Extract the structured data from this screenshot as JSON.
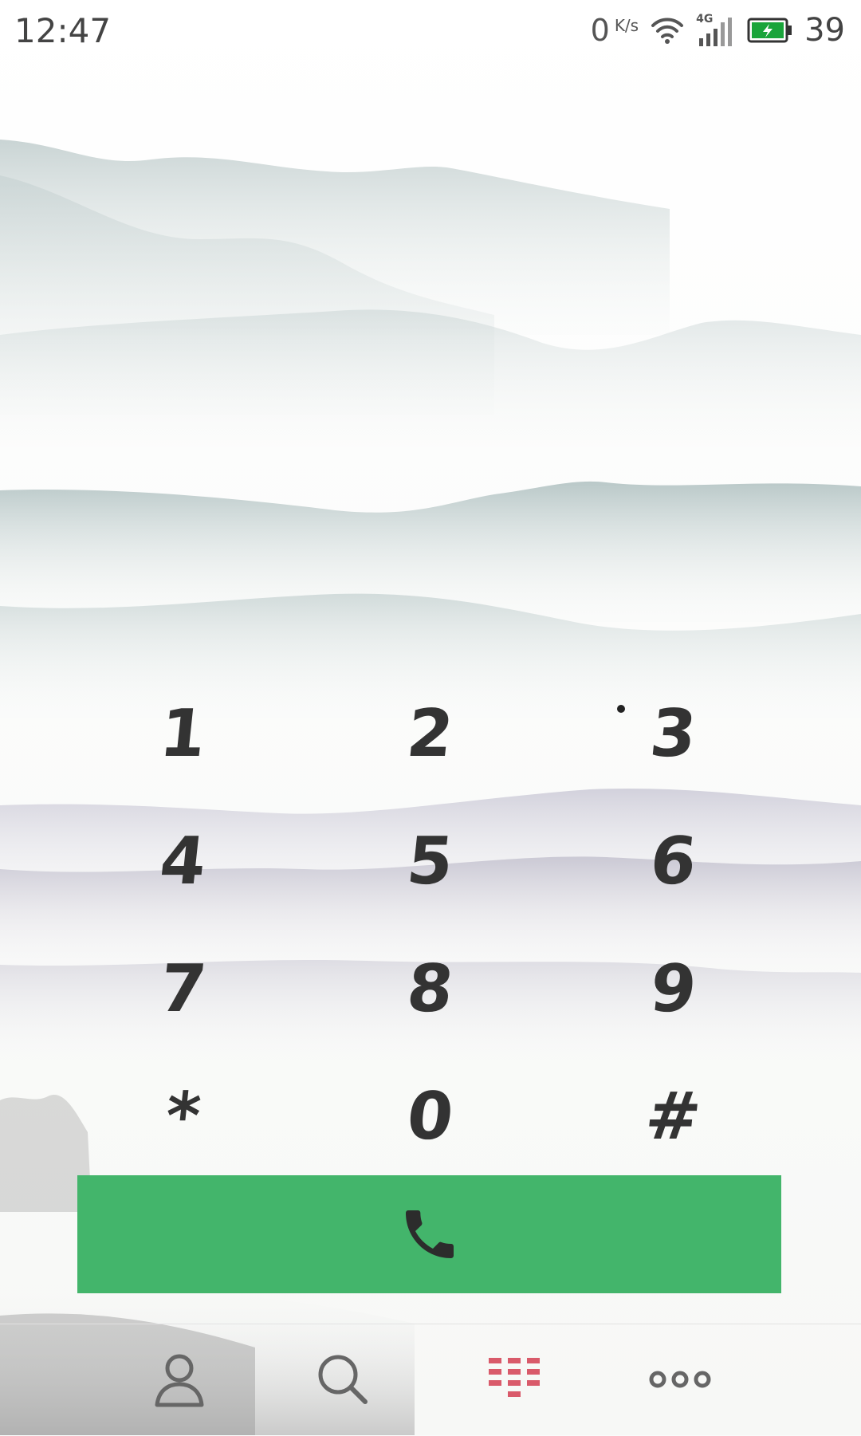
{
  "status_bar": {
    "time": "12:47",
    "net_speed_value": "0",
    "net_speed_unit": "K/s",
    "network_type": "4G",
    "battery_percent": "39",
    "battery_color": "#19a43a"
  },
  "dialpad": {
    "keys": [
      "1",
      "2",
      "3",
      "4",
      "5",
      "6",
      "7",
      "8",
      "9",
      "*",
      "0",
      "#"
    ]
  },
  "call_button": {
    "icon": "phone-icon",
    "color": "#43b56b"
  },
  "bottom_nav": {
    "items": [
      {
        "icon": "contacts-icon",
        "active": false
      },
      {
        "icon": "search-icon",
        "active": false
      },
      {
        "icon": "dialpad-icon",
        "active": true
      },
      {
        "icon": "more-icon",
        "active": false
      }
    ],
    "active_color": "#d95a6a"
  }
}
